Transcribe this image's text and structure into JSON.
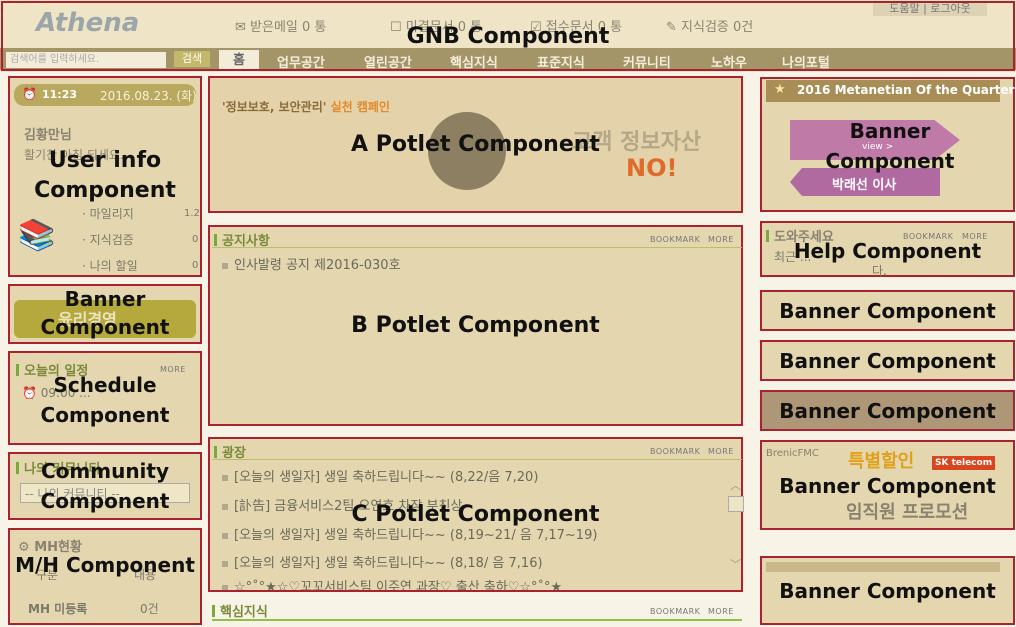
{
  "gnb": {
    "logo": "Athena",
    "stats": [
      "받은메일 0 통",
      "미결문서 0 통",
      "접수문서 0 통",
      "지식검증 0건"
    ],
    "util": "도움말 | 로그아웃",
    "search_placeholder": "검색어를 입력하세요.",
    "search_button": "검색",
    "nav": [
      "홈",
      "업무공간",
      "열린공간",
      "핵심지식",
      "표준지식",
      "커뮤니티",
      "노하우",
      "나의포털"
    ],
    "annotation": "GNB Component"
  },
  "userinfo": {
    "time": "11:23",
    "date": "2016.08.23. (화)",
    "name": "김황만님",
    "greeting": "활기찬 아침 되세요.",
    "rows": [
      {
        "label": "마일리지",
        "value": "1.2"
      },
      {
        "label": "지식검증",
        "value": "0"
      },
      {
        "label": "나의 할일",
        "value": "0"
      }
    ],
    "annotation": "User info Component"
  },
  "banner_left": {
    "text": "윤리경영",
    "annotation": "Banner Component"
  },
  "schedule": {
    "title": "오늘의 일정",
    "more": "MORE",
    "item": "09:00 ...",
    "annotation": "Schedule Component"
  },
  "community": {
    "title": "나의 커뮤니티",
    "select": "-- 나의 커뮤니티 --",
    "annotation": "Community Component"
  },
  "mh": {
    "title": "MH현황",
    "col1": "구분",
    "col2": "내용",
    "row_label": "MH 미등록",
    "row_value": "0건",
    "annotation": "M/H Component"
  },
  "potlet_a": {
    "slogan_a": "'정보보호, 보안관리'",
    "slogan_b": "실천 캠페인",
    "text_a": "고객 정보자산",
    "text_b": "NO!",
    "annotation": "A Potlet Component"
  },
  "potlet_b": {
    "title": "공지사항",
    "bookmark": "BOOKMARK",
    "more": "MORE",
    "items": [
      "인사발령 공지 제2016-030호"
    ],
    "annotation": "B Potlet Component"
  },
  "potlet_c": {
    "title": "광장",
    "bookmark": "BOOKMARK",
    "more": "MORE",
    "items": [
      "[오늘의 생일자] 생일 축하드립니다~~ (8,22/음 7,20)",
      "[訃告] 금융서비스2팀 오연호 차장 부친상",
      "[오늘의 생일자] 생일 축하드립니다~~ (8,19~21/ 음 7,17~19)",
      "[오늘의 생일자] 생일 축하드립니다~~ (8,18/ 음 7,16)",
      "☆°˚°★☆♡꼬꼬서비스팀 이주연 과장♡ 출산 축하♡☆°˚°★"
    ],
    "annotation": "C Potlet Component"
  },
  "core": {
    "title": "핵심지식",
    "bookmark": "BOOKMARK",
    "more": "MORE"
  },
  "right": {
    "metanetian": {
      "title": "2016 Metanetian Of the Quarter",
      "view": "view >",
      "name": "박래선 이사",
      "annotation": "Banner Component"
    },
    "help": {
      "title": "도와주세요",
      "bookmark": "BOOKMARK",
      "more": "MORE",
      "body": "최근 ...",
      "tail": "다.",
      "annotation": "Help Component"
    },
    "banners": [
      {
        "annotation": "Banner Component"
      },
      {
        "annotation": "Banner Component"
      },
      {
        "annotation": "Banner Component"
      }
    ],
    "promo": {
      "brand": "BrenicFMC",
      "headline": "특별할인",
      "carrier": "SK telecom",
      "sub": "임직원 프로모션",
      "annotation": "Banner Component"
    },
    "last": {
      "annotation": "Banner Component"
    }
  },
  "colors": {
    "accent_border": "#a8232f",
    "nav_bg": "#9c8f63",
    "green": "#7aa83a",
    "orange": "#e06a2a"
  }
}
